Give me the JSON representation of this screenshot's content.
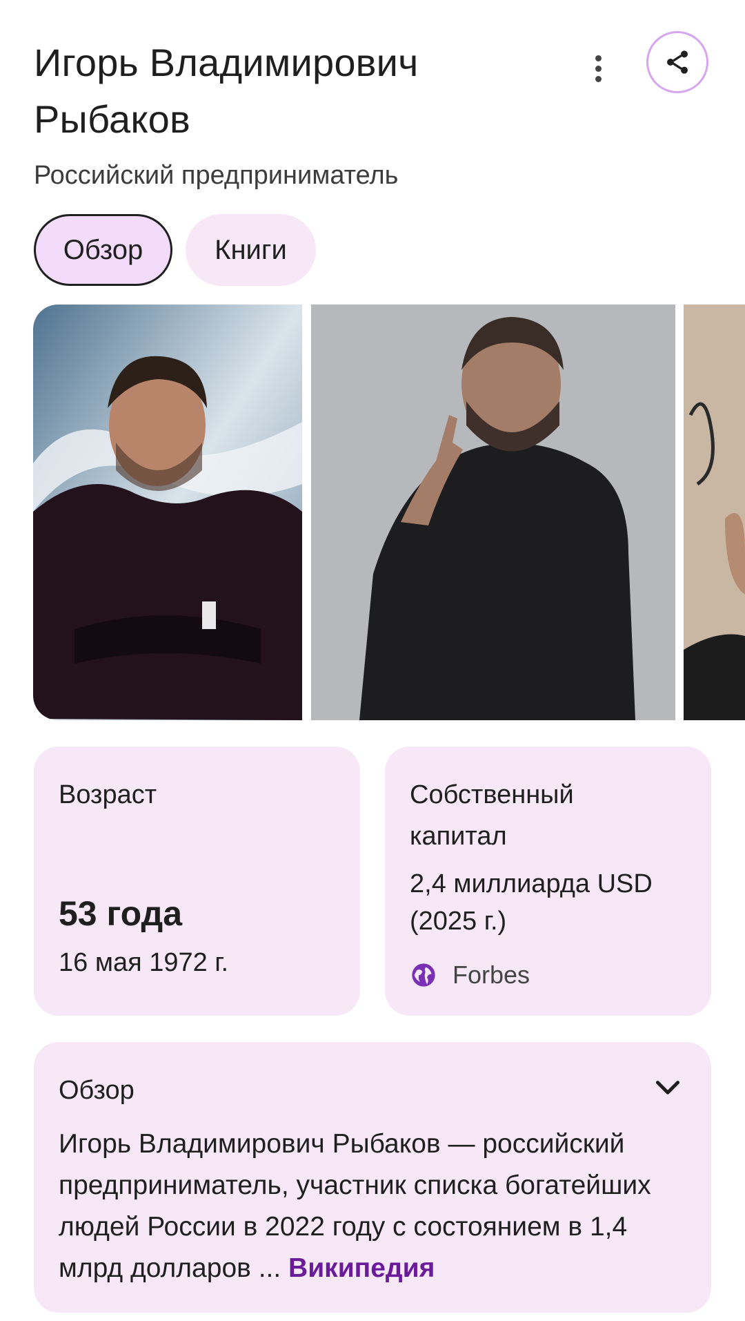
{
  "header": {
    "title": "Игорь Владимирович Рыбаков",
    "subtitle": "Российский предприниматель"
  },
  "tabs": [
    {
      "label": "Обзор",
      "active": true
    },
    {
      "label": "Книги",
      "active": false
    }
  ],
  "gallery": {
    "photos": [
      {
        "description_icon": "person-photo"
      },
      {
        "description_icon": "person-photo"
      },
      {
        "description_icon": "person-photo-partial"
      }
    ]
  },
  "age_card": {
    "label": "Возраст",
    "value": "53 года",
    "birth_date": "16 мая 1972 г."
  },
  "capital_card": {
    "label": "Собственный капитал",
    "value": "2,4 миллиарда USD (2025 г.)",
    "source": "Forbes",
    "source_icon": "globe-icon"
  },
  "overview": {
    "title": "Обзор",
    "text": "Игорь Владимирович Рыбаков — российский предприниматель, участник списка богатейших людей России в 2022 году с состоянием в 1,4 млрд долларов",
    "ellipsis": " ... ",
    "link": "Википедия"
  },
  "colors": {
    "card_bg": "#f7e8f8",
    "chip_active_bg": "#f3dbfb",
    "accent_purple": "#6a1b9a",
    "share_border": "#d6a6ee"
  }
}
